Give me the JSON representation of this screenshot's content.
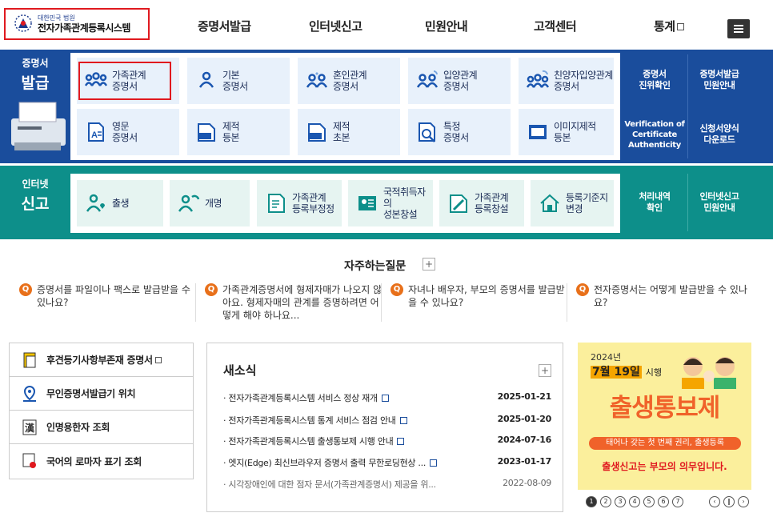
{
  "header": {
    "logo_small": "대한민국 법원",
    "logo_main": "전자가족관계등록시스템",
    "nav": [
      "증명서발급",
      "인터넷신고",
      "민원안내",
      "고객센터",
      "통계"
    ]
  },
  "certificate": {
    "title_small": "증명서",
    "title_big": "발급",
    "tiles": [
      {
        "l1": "가족관계",
        "l2": "증명서",
        "icon": "family-icon"
      },
      {
        "l1": "기본",
        "l2": "증명서",
        "icon": "person-icon"
      },
      {
        "l1": "혼인관계",
        "l2": "증명서",
        "icon": "couple-icon"
      },
      {
        "l1": "입양관계",
        "l2": "증명서",
        "icon": "adoption-icon"
      },
      {
        "l1": "친양자입양관계",
        "l2": "증명서",
        "icon": "adoptive-family-icon"
      },
      {
        "l1": "영문",
        "l2": "증명서",
        "icon": "english-doc-icon"
      },
      {
        "l1": "제적",
        "l2": "등본",
        "icon": "removed-doc-icon"
      },
      {
        "l1": "제적",
        "l2": "초본",
        "icon": "removed-extract-icon"
      },
      {
        "l1": "특정",
        "l2": "증명서",
        "icon": "magnifier-doc-icon"
      },
      {
        "l1": "이미지제적",
        "l2": "등본",
        "icon": "image-doc-icon"
      }
    ],
    "side": [
      {
        "l1": "증명서",
        "l2": "진위확인"
      },
      {
        "l1": "증명서발급",
        "l2": "민원안내"
      },
      {
        "l1": "Verification of",
        "l2": "Certificate",
        "l3": "Authenticity"
      },
      {
        "l1": "신청서양식",
        "l2": "다운로드"
      }
    ]
  },
  "internet": {
    "title_small": "인터넷",
    "title_big": "신고",
    "tiles": [
      {
        "l1": "출생",
        "l2": "",
        "icon": "baby-icon"
      },
      {
        "l1": "개명",
        "l2": "",
        "icon": "rename-icon"
      },
      {
        "l1": "가족관계",
        "l2": "등록부정정",
        "icon": "correction-icon"
      },
      {
        "l1": "국적취득자의",
        "l2": "성본창설",
        "icon": "nationality-icon"
      },
      {
        "l1": "가족관계",
        "l2": "등록창설",
        "icon": "create-register-icon"
      },
      {
        "l1": "등록기준지",
        "l2": "변경",
        "icon": "house-icon"
      }
    ],
    "side": [
      {
        "l1": "처리내역",
        "l2": "확인"
      },
      {
        "l1": "인터넷신고",
        "l2": "민원안내"
      }
    ]
  },
  "faq": {
    "title": "자주하는질문",
    "items": [
      "증명서를 파일이나 팩스로 발급받을 수 있나요?",
      "가족관계증명서에 형제자매가 나오지 않아요. 형제자매의 관계를 증명하려면 어떻게 해야 하나요...",
      "자녀나 배우자, 부모의 증명서를 발급받을 수 있나요?",
      "전자증명서는 어떻게 발급받을 수 있나요?"
    ]
  },
  "quick_links": [
    "후견등기사항부존재 증명서",
    "무인증명서발급기 위치",
    "인명용한자 조회",
    "국어의 로마자 표기 조회"
  ],
  "news": {
    "title": "새소식",
    "items": [
      {
        "title": "전자가족관계등록시스템 서비스 정상 재개",
        "date": "2025-01-21"
      },
      {
        "title": "전자가족관계등록시스템 통계 서비스 점검 안내",
        "date": "2025-01-20"
      },
      {
        "title": "전자가족관계등록시스템 출생통보제 시행 안내",
        "date": "2024-07-16"
      },
      {
        "title": "엣지(Edge) 최신브라우저 증명서 출력 무한로딩현상 ...",
        "date": "2023-01-17"
      },
      {
        "title": "시각장애인에 대한 점자 문서(가족관계증명서) 제공을 위...",
        "date": "2022-08-09"
      }
    ]
  },
  "banner": {
    "year": "2024년",
    "date": "7월 19일",
    "date_suffix": "시행",
    "headline": "출생통보제",
    "sub1": "태어나 갖는 첫 번째 권리, 출생등록",
    "sub2": "출생신고는 부모의 의무입니다."
  },
  "pager": {
    "pages": [
      "1",
      "2",
      "3",
      "4",
      "5",
      "6",
      "7"
    ]
  }
}
